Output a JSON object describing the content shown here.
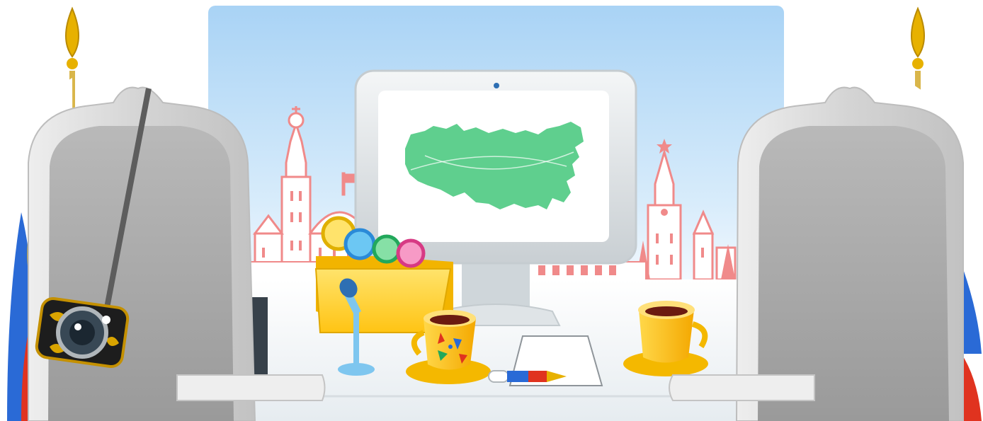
{
  "scene": {
    "backdrop": "kremlin-skyline",
    "colors": {
      "sky_top": "#a9d3f5",
      "sky_bottom": "#e9f4fd",
      "kremlin": "#f08a8a",
      "map_green": "#5fcf8e",
      "monitor_frame": "#dfe3e6",
      "chair": "#cfcfcf",
      "chair_back": "#a4a4a4",
      "cup": "#ffc20e",
      "coffee": "#6b1b10",
      "flag_white": "#ffffff",
      "flag_blue": "#2a6ad6",
      "flag_red": "#e0331f",
      "gold": "#e7b100"
    },
    "items": {
      "monitor": "monitor-with-russia-map",
      "folder": "yellow-folder-with-cards",
      "microphone": "microphone",
      "left_cup": "painted-cup",
      "right_cup": "plain-cup",
      "pen": "tricolor-pen",
      "paper": "blank-sheet",
      "camera": "khokhloma-camera",
      "left_chair": "left-armchair",
      "right_chair": "right-armchair",
      "left_flag": "left-flag",
      "right_flag": "right-flag"
    }
  }
}
